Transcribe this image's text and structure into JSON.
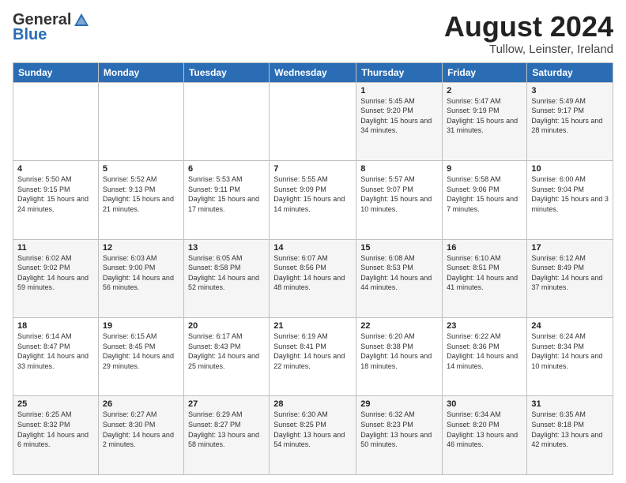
{
  "header": {
    "logo_general": "General",
    "logo_blue": "Blue",
    "month_title": "August 2024",
    "location": "Tullow, Leinster, Ireland"
  },
  "weekdays": [
    "Sunday",
    "Monday",
    "Tuesday",
    "Wednesday",
    "Thursday",
    "Friday",
    "Saturday"
  ],
  "weeks": [
    [
      {
        "day": "",
        "sunrise": "",
        "sunset": "",
        "daylight": ""
      },
      {
        "day": "",
        "sunrise": "",
        "sunset": "",
        "daylight": ""
      },
      {
        "day": "",
        "sunrise": "",
        "sunset": "",
        "daylight": ""
      },
      {
        "day": "",
        "sunrise": "",
        "sunset": "",
        "daylight": ""
      },
      {
        "day": "1",
        "sunrise": "Sunrise: 5:45 AM",
        "sunset": "Sunset: 9:20 PM",
        "daylight": "Daylight: 15 hours and 34 minutes."
      },
      {
        "day": "2",
        "sunrise": "Sunrise: 5:47 AM",
        "sunset": "Sunset: 9:19 PM",
        "daylight": "Daylight: 15 hours and 31 minutes."
      },
      {
        "day": "3",
        "sunrise": "Sunrise: 5:49 AM",
        "sunset": "Sunset: 9:17 PM",
        "daylight": "Daylight: 15 hours and 28 minutes."
      }
    ],
    [
      {
        "day": "4",
        "sunrise": "Sunrise: 5:50 AM",
        "sunset": "Sunset: 9:15 PM",
        "daylight": "Daylight: 15 hours and 24 minutes."
      },
      {
        "day": "5",
        "sunrise": "Sunrise: 5:52 AM",
        "sunset": "Sunset: 9:13 PM",
        "daylight": "Daylight: 15 hours and 21 minutes."
      },
      {
        "day": "6",
        "sunrise": "Sunrise: 5:53 AM",
        "sunset": "Sunset: 9:11 PM",
        "daylight": "Daylight: 15 hours and 17 minutes."
      },
      {
        "day": "7",
        "sunrise": "Sunrise: 5:55 AM",
        "sunset": "Sunset: 9:09 PM",
        "daylight": "Daylight: 15 hours and 14 minutes."
      },
      {
        "day": "8",
        "sunrise": "Sunrise: 5:57 AM",
        "sunset": "Sunset: 9:07 PM",
        "daylight": "Daylight: 15 hours and 10 minutes."
      },
      {
        "day": "9",
        "sunrise": "Sunrise: 5:58 AM",
        "sunset": "Sunset: 9:06 PM",
        "daylight": "Daylight: 15 hours and 7 minutes."
      },
      {
        "day": "10",
        "sunrise": "Sunrise: 6:00 AM",
        "sunset": "Sunset: 9:04 PM",
        "daylight": "Daylight: 15 hours and 3 minutes."
      }
    ],
    [
      {
        "day": "11",
        "sunrise": "Sunrise: 6:02 AM",
        "sunset": "Sunset: 9:02 PM",
        "daylight": "Daylight: 14 hours and 59 minutes."
      },
      {
        "day": "12",
        "sunrise": "Sunrise: 6:03 AM",
        "sunset": "Sunset: 9:00 PM",
        "daylight": "Daylight: 14 hours and 56 minutes."
      },
      {
        "day": "13",
        "sunrise": "Sunrise: 6:05 AM",
        "sunset": "Sunset: 8:58 PM",
        "daylight": "Daylight: 14 hours and 52 minutes."
      },
      {
        "day": "14",
        "sunrise": "Sunrise: 6:07 AM",
        "sunset": "Sunset: 8:56 PM",
        "daylight": "Daylight: 14 hours and 48 minutes."
      },
      {
        "day": "15",
        "sunrise": "Sunrise: 6:08 AM",
        "sunset": "Sunset: 8:53 PM",
        "daylight": "Daylight: 14 hours and 44 minutes."
      },
      {
        "day": "16",
        "sunrise": "Sunrise: 6:10 AM",
        "sunset": "Sunset: 8:51 PM",
        "daylight": "Daylight: 14 hours and 41 minutes."
      },
      {
        "day": "17",
        "sunrise": "Sunrise: 6:12 AM",
        "sunset": "Sunset: 8:49 PM",
        "daylight": "Daylight: 14 hours and 37 minutes."
      }
    ],
    [
      {
        "day": "18",
        "sunrise": "Sunrise: 6:14 AM",
        "sunset": "Sunset: 8:47 PM",
        "daylight": "Daylight: 14 hours and 33 minutes."
      },
      {
        "day": "19",
        "sunrise": "Sunrise: 6:15 AM",
        "sunset": "Sunset: 8:45 PM",
        "daylight": "Daylight: 14 hours and 29 minutes."
      },
      {
        "day": "20",
        "sunrise": "Sunrise: 6:17 AM",
        "sunset": "Sunset: 8:43 PM",
        "daylight": "Daylight: 14 hours and 25 minutes."
      },
      {
        "day": "21",
        "sunrise": "Sunrise: 6:19 AM",
        "sunset": "Sunset: 8:41 PM",
        "daylight": "Daylight: 14 hours and 22 minutes."
      },
      {
        "day": "22",
        "sunrise": "Sunrise: 6:20 AM",
        "sunset": "Sunset: 8:38 PM",
        "daylight": "Daylight: 14 hours and 18 minutes."
      },
      {
        "day": "23",
        "sunrise": "Sunrise: 6:22 AM",
        "sunset": "Sunset: 8:36 PM",
        "daylight": "Daylight: 14 hours and 14 minutes."
      },
      {
        "day": "24",
        "sunrise": "Sunrise: 6:24 AM",
        "sunset": "Sunset: 8:34 PM",
        "daylight": "Daylight: 14 hours and 10 minutes."
      }
    ],
    [
      {
        "day": "25",
        "sunrise": "Sunrise: 6:25 AM",
        "sunset": "Sunset: 8:32 PM",
        "daylight": "Daylight: 14 hours and 6 minutes."
      },
      {
        "day": "26",
        "sunrise": "Sunrise: 6:27 AM",
        "sunset": "Sunset: 8:30 PM",
        "daylight": "Daylight: 14 hours and 2 minutes."
      },
      {
        "day": "27",
        "sunrise": "Sunrise: 6:29 AM",
        "sunset": "Sunset: 8:27 PM",
        "daylight": "Daylight: 13 hours and 58 minutes."
      },
      {
        "day": "28",
        "sunrise": "Sunrise: 6:30 AM",
        "sunset": "Sunset: 8:25 PM",
        "daylight": "Daylight: 13 hours and 54 minutes."
      },
      {
        "day": "29",
        "sunrise": "Sunrise: 6:32 AM",
        "sunset": "Sunset: 8:23 PM",
        "daylight": "Daylight: 13 hours and 50 minutes."
      },
      {
        "day": "30",
        "sunrise": "Sunrise: 6:34 AM",
        "sunset": "Sunset: 8:20 PM",
        "daylight": "Daylight: 13 hours and 46 minutes."
      },
      {
        "day": "31",
        "sunrise": "Sunrise: 6:35 AM",
        "sunset": "Sunset: 8:18 PM",
        "daylight": "Daylight: 13 hours and 42 minutes."
      }
    ]
  ]
}
